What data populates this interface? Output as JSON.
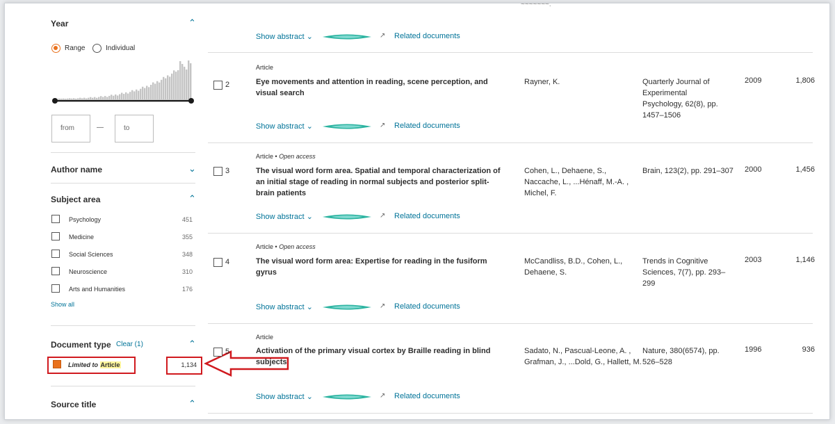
{
  "sidebar": {
    "year": {
      "heading": "Year",
      "range_label": "Range",
      "individual_label": "Individual",
      "from_placeholder": "from",
      "dash": "—",
      "to_placeholder": "to"
    },
    "author_heading": "Author name",
    "subject": {
      "heading": "Subject area",
      "items": [
        {
          "label": "Psychology",
          "count": "451"
        },
        {
          "label": "Medicine",
          "count": "355"
        },
        {
          "label": "Social Sciences",
          "count": "348"
        },
        {
          "label": "Neuroscience",
          "count": "310"
        },
        {
          "label": "Arts and Humanities",
          "count": "176"
        }
      ],
      "show_all": "Show all"
    },
    "doctype": {
      "heading": "Document type",
      "clear": "Clear (1)",
      "limited_prefix": "Limited to",
      "limited_value": "Article",
      "count": "1,134"
    },
    "source_heading": "Source title"
  },
  "results": {
    "top_partial": {
      "show_abstract": "Show abstract",
      "related": "Related documents"
    },
    "rows": [
      {
        "num": "2",
        "type": "Article",
        "open_access": "",
        "title": "Eye movements and attention in reading, scene perception, and visual search",
        "authors": "Rayner, K.",
        "source": "Quarterly Journal of Experimental Psychology, 62(8), pp. 1457–1506",
        "year": "2009",
        "cited": "1,806",
        "show_abstract": "Show abstract",
        "related": "Related documents"
      },
      {
        "num": "3",
        "type": "Article",
        "open_access": "Open access",
        "title": "The visual word form area. Spatial and temporal characterization of an initial stage of reading in normal subjects and posterior split-brain patients",
        "authors": "Cohen, L., Dehaene, S., Naccache, L., ...Hénaff, M.-A. , Michel, F.",
        "source": "Brain, 123(2), pp. 291–307",
        "year": "2000",
        "cited": "1,456",
        "show_abstract": "Show abstract",
        "related": "Related documents"
      },
      {
        "num": "4",
        "type": "Article",
        "open_access": "Open access",
        "title": "The visual word form area: Expertise for reading in the fusiform gyrus",
        "authors": "McCandliss, B.D., Cohen, L., Dehaene, S.",
        "source": "Trends in Cognitive Sciences, 7(7), pp. 293–299",
        "year": "2003",
        "cited": "1,146",
        "show_abstract": "Show abstract",
        "related": "Related documents"
      },
      {
        "num": "5",
        "type": "Article",
        "open_access": "",
        "title": "Activation of the primary visual cortex by Braille reading in blind subjects",
        "authors": "Sadato, N., Pascual-Leone, A. , Grafman, J., ...Dold, G., Hallett, M.",
        "source": "Nature, 380(6574), pp. 526–528",
        "year": "1996",
        "cited": "936",
        "show_abstract": "Show abstract",
        "related": "Related documents"
      }
    ],
    "type_separator": "•"
  },
  "icons": {
    "chevron_up": "chevron-up-icon",
    "chevron_down": "chevron-down-icon",
    "external": "external-link-icon",
    "arrow": "annotation-arrow-icon"
  },
  "colors": {
    "accent": "#007398",
    "radio_selected": "#e9711c",
    "annotation_red": "#d0191e",
    "highlight": "#fff59d"
  }
}
